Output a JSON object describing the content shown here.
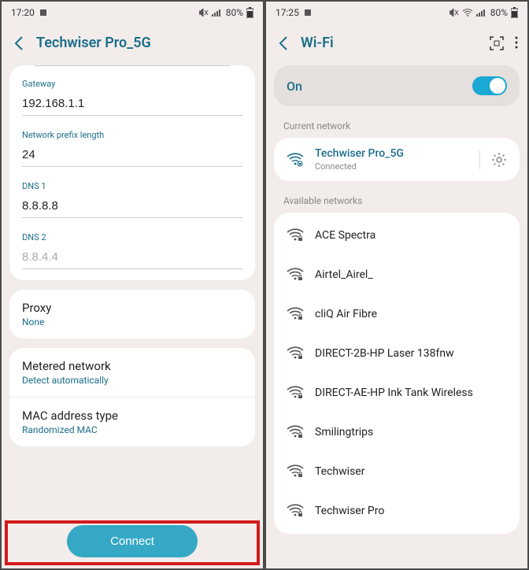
{
  "left": {
    "status": {
      "time": "17:20",
      "battery": "80%"
    },
    "header": {
      "title": "Techwiser Pro_5G"
    },
    "gateway": {
      "label": "Gateway",
      "value": "192.168.1.1"
    },
    "prefix": {
      "label": "Network prefix length",
      "value": "24"
    },
    "dns1": {
      "label": "DNS 1",
      "value": "8.8.8.8"
    },
    "dns2": {
      "label": "DNS 2",
      "placeholder": "8.8.4.4"
    },
    "proxy": {
      "title": "Proxy",
      "value": "None"
    },
    "metered": {
      "title": "Metered network",
      "value": "Detect automatically"
    },
    "mac": {
      "title": "MAC address type",
      "value": "Randomized MAC"
    },
    "connect_label": "Connect"
  },
  "right": {
    "status": {
      "time": "17:25",
      "battery": "80%"
    },
    "header": {
      "title": "Wi-Fi"
    },
    "toggle": {
      "label": "On"
    },
    "current_label": "Current network",
    "current": {
      "name": "Techwiser Pro_5G",
      "status": "Connected"
    },
    "available_label": "Available networks",
    "networks": [
      {
        "name": "ACE Spectra"
      },
      {
        "name": "Airtel_Airel_"
      },
      {
        "name": "cliQ Air Fibre"
      },
      {
        "name": "DIRECT-2B-HP Laser 138fnw"
      },
      {
        "name": "DIRECT-AE-HP Ink Tank Wireless"
      },
      {
        "name": "Smilingtrips"
      },
      {
        "name": "Techwiser"
      },
      {
        "name": "Techwiser Pro"
      }
    ]
  }
}
